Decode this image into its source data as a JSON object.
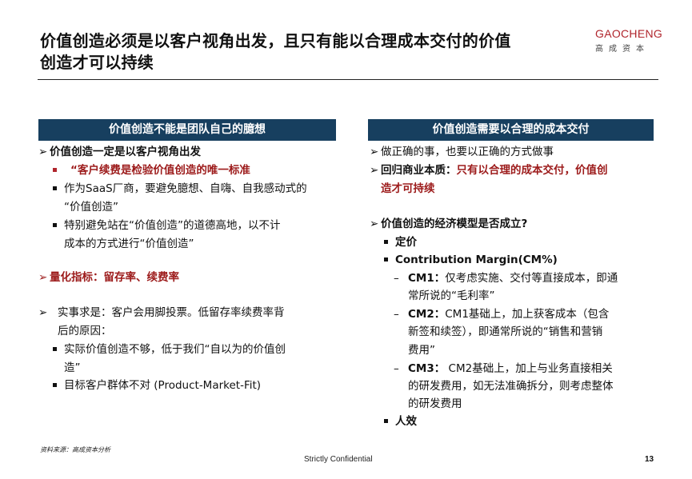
{
  "title": {
    "line1": "价值创造必须是以客户视角出发，且只有能以合理成本交付的价值",
    "line2": "创造才可以持续"
  },
  "logo": {
    "en": "GAOCHENG",
    "cn": "高成资本"
  },
  "left": {
    "header": "价值创造不能是团队自己的臆想",
    "l1": "价值创造一定是以客户视角出发",
    "l2": "“客户续费是检验价值创造的唯一标准",
    "l3a": "作为SaaS厂商，要避免臆想、自嗨、自我感动式的",
    "l3b": "“价值创造”",
    "l4a": "特别避免站在“价值创造”的道德高地，以不计",
    "l4b": "成本的方式进行“价值创造”",
    "l5": "量化指标：留存率、续费率",
    "l6a": "实事求是：客户会用脚投票。低留存率续费率背",
    "l6b": "后的原因：",
    "l7a": "实际价值创造不够，低于我们“自以为的价值创",
    "l7b": "造”",
    "l8": "目标客户群体不对 (Product-Market-Fit)"
  },
  "right": {
    "header": "价值创造需要以合理的成本交付",
    "r1": "做正确的事，也要以正确的方式做事",
    "r2_label": "回归商业本质：",
    "r2a": "只有以合理的成本交付，价值创",
    "r2b": "造才可持续",
    "r3": "价值创造的经济模型是否成立?",
    "r4": "定价",
    "r5": "Contribution Margin(CM%)",
    "cm1_label": "CM1：",
    "cm1a": "仅考虑实施、交付等直接成本，即通",
    "cm1b": "常所说的“毛利率”",
    "cm2_label": "CM2：",
    "cm2a": "CM1基础上，加上获客成本（包含",
    "cm2b": "新签和续签），即通常所说的“销售和营销",
    "cm2c": "费用”",
    "cm3_label": "CM3：",
    "cm3a": " CM2基础上，加上与业务直接相关",
    "cm3b": "的研发费用，如无法准确拆分，则考虑整体",
    "cm3c": "的研发费用",
    "r6": "人效"
  },
  "footer": {
    "source": "资料来源：高成资本分析",
    "confidential": "Strictly Confidential",
    "page": "13"
  }
}
